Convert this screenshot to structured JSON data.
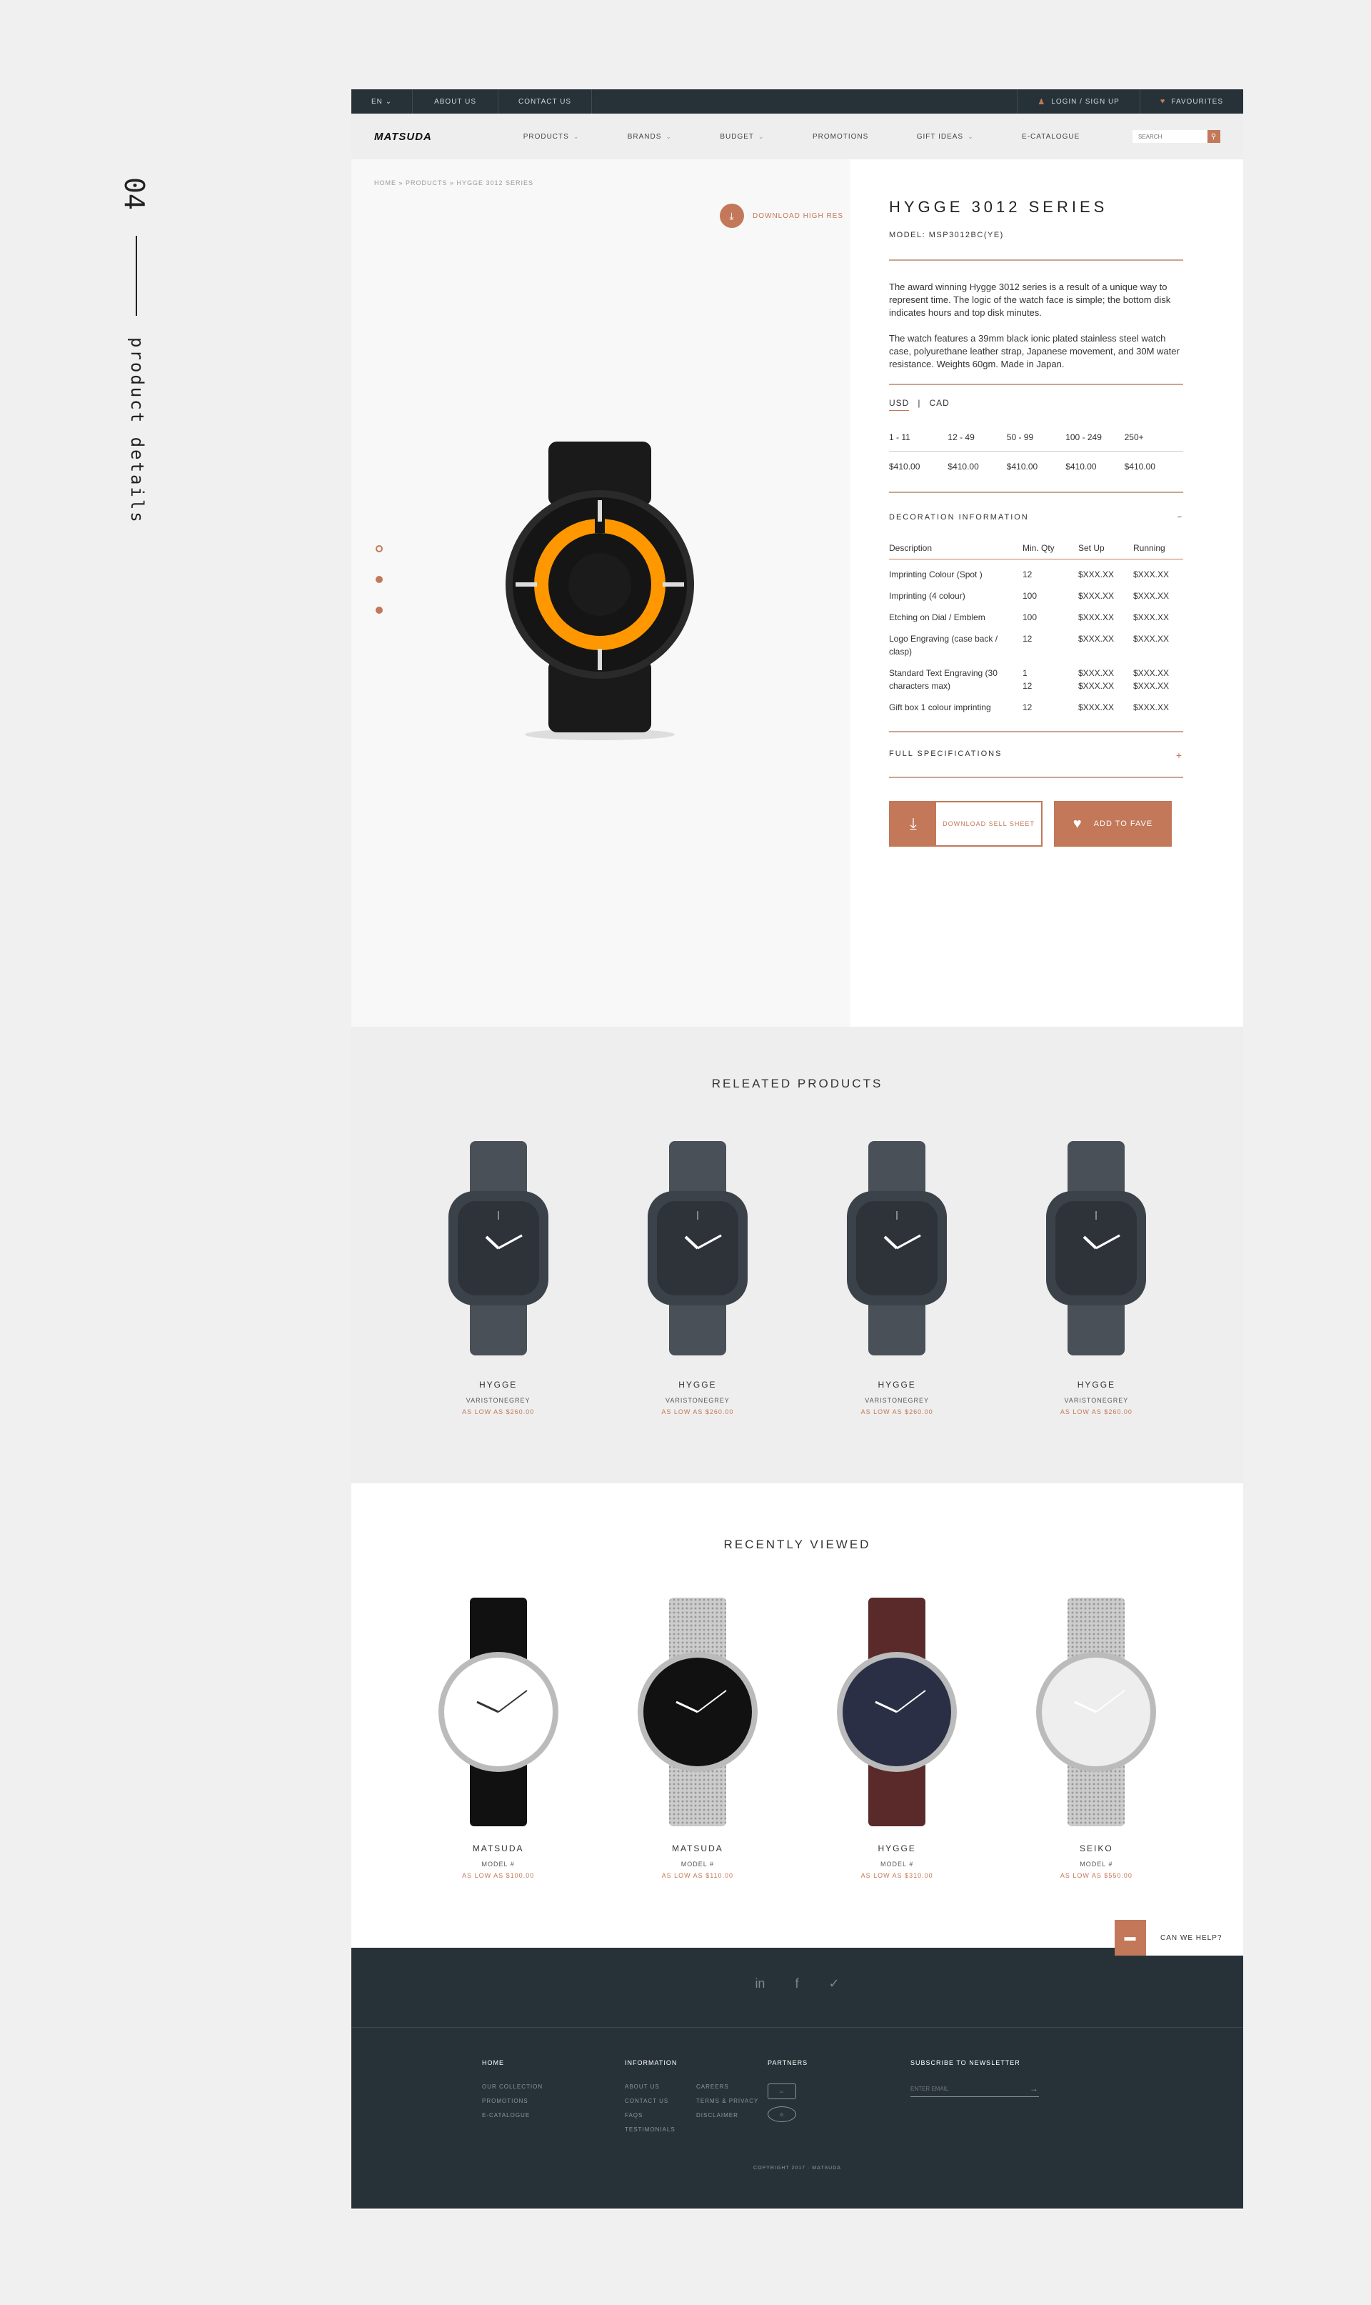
{
  "side": {
    "number": "04",
    "label": "product details"
  },
  "topbar": {
    "lang": "EN",
    "about": "ABOUT US",
    "contact": "CONTACT US",
    "login": "LOGIN / SIGN UP",
    "favourites": "FAVOURITES"
  },
  "nav": {
    "logo": "MATSUDA",
    "items": [
      "PRODUCTS",
      "BRANDS",
      "BUDGET",
      "PROMOTIONS",
      "GIFT IDEAS",
      "E-CATALOGUE"
    ],
    "search_placeholder": "SEARCH"
  },
  "breadcrumb": "HOME » PRODUCTS » HYGGE 3012 SERIES",
  "download_hires": "DOWNLOAD HIGH RES",
  "product": {
    "title": "HYGGE 3012 SERIES",
    "model": "MODEL: MSP3012BC(YE)",
    "desc1": "The award winning Hygge 3012 series is a result of a unique way to represent time. The logic of the watch face is simple; the bottom disk indicates hours and top disk minutes.",
    "desc2": "The watch features a 39mm black ionic plated stainless steel watch case, polyurethane leather strap, Japanese movement, and 30M water resistance. Weights 60gm. Made in Japan.",
    "currencies": [
      "USD",
      "CAD"
    ],
    "qty": [
      "1 - 11",
      "12 - 49",
      "50 - 99",
      "100 - 249",
      "250+"
    ],
    "prices": [
      "$410.00",
      "$410.00",
      "$410.00",
      "$410.00",
      "$410.00"
    ],
    "deco_title": "DECORATION INFORMATION",
    "deco_toggle": "−",
    "deco_headers": [
      "Description",
      "Min. Qty",
      "Set Up",
      "Running"
    ],
    "deco_rows": [
      {
        "desc": "Imprinting Colour (Spot )",
        "qty": "12",
        "setup": "$XXX.XX",
        "run": "$XXX.XX"
      },
      {
        "desc": "Imprinting (4 colour)",
        "qty": "100",
        "setup": "$XXX.XX",
        "run": "$XXX.XX"
      },
      {
        "desc": "Etching on Dial / Emblem",
        "qty": "100",
        "setup": "$XXX.XX",
        "run": "$XXX.XX"
      },
      {
        "desc": "Logo Engraving (case back / clasp)",
        "qty": "12",
        "setup": "$XXX.XX",
        "run": "$XXX.XX"
      },
      {
        "desc": "Standard Text Engraving (30 characters max)",
        "qty": "1\n12",
        "setup": "$XXX.XX\n$XXX.XX",
        "run": "$XXX.XX\n$XXX.XX"
      },
      {
        "desc": "Gift box 1 colour imprinting",
        "qty": "12",
        "setup": "$XXX.XX",
        "run": "$XXX.XX"
      }
    ],
    "spec_title": "FULL SPECIFICATIONS",
    "spec_toggle": "+",
    "btn_download": "DOWNLOAD SELL SHEET",
    "btn_fave": "ADD TO FAVE"
  },
  "related": {
    "title": "RELEATED PRODUCTS",
    "items": [
      {
        "name": "HYGGE",
        "sub": "VARISTONEGREY",
        "price": "AS LOW AS $260.00"
      },
      {
        "name": "HYGGE",
        "sub": "VARISTONEGREY",
        "price": "AS LOW AS $260.00"
      },
      {
        "name": "HYGGE",
        "sub": "VARISTONEGREY",
        "price": "AS LOW AS $260.00"
      },
      {
        "name": "HYGGE",
        "sub": "VARISTONEGREY",
        "price": "AS LOW AS $260.00"
      }
    ]
  },
  "recent": {
    "title": "RECENTLY VIEWED",
    "items": [
      {
        "name": "MATSUDA",
        "sub": "MODEL #",
        "price": "AS LOW AS $100.00"
      },
      {
        "name": "MATSUDA",
        "sub": "MODEL #",
        "price": "AS LOW AS $110.00"
      },
      {
        "name": "HYGGE",
        "sub": "MODEL #",
        "price": "AS LOW AS $310.00"
      },
      {
        "name": "SEIKO",
        "sub": "MODEL #",
        "price": "AS LOW AS $550.00"
      }
    ]
  },
  "help": "CAN WE HELP?",
  "footer": {
    "col1": {
      "head": "HOME",
      "links": [
        "OUR COLLECTION",
        "PROMOTIONS",
        "E-CATALOGUE"
      ]
    },
    "col2": {
      "head": "INFORMATION",
      "links": [
        "ABOUT US",
        "CONTACT US",
        "FAQS",
        "TESTIMONIALS"
      ],
      "links2": [
        "CAREERS",
        "TERMS & PRIVACY",
        "DISCLAIMER"
      ]
    },
    "col3": {
      "head": "PARTNERS"
    },
    "col4": {
      "head": "SUBSCRIBE TO NEWSLETTER",
      "placeholder": "ENTER EMAIL"
    },
    "copyright": "COPYRIGHT 2017 · MATSUDA"
  },
  "colors": {
    "accent": "#c27859",
    "dark": "#263238"
  }
}
